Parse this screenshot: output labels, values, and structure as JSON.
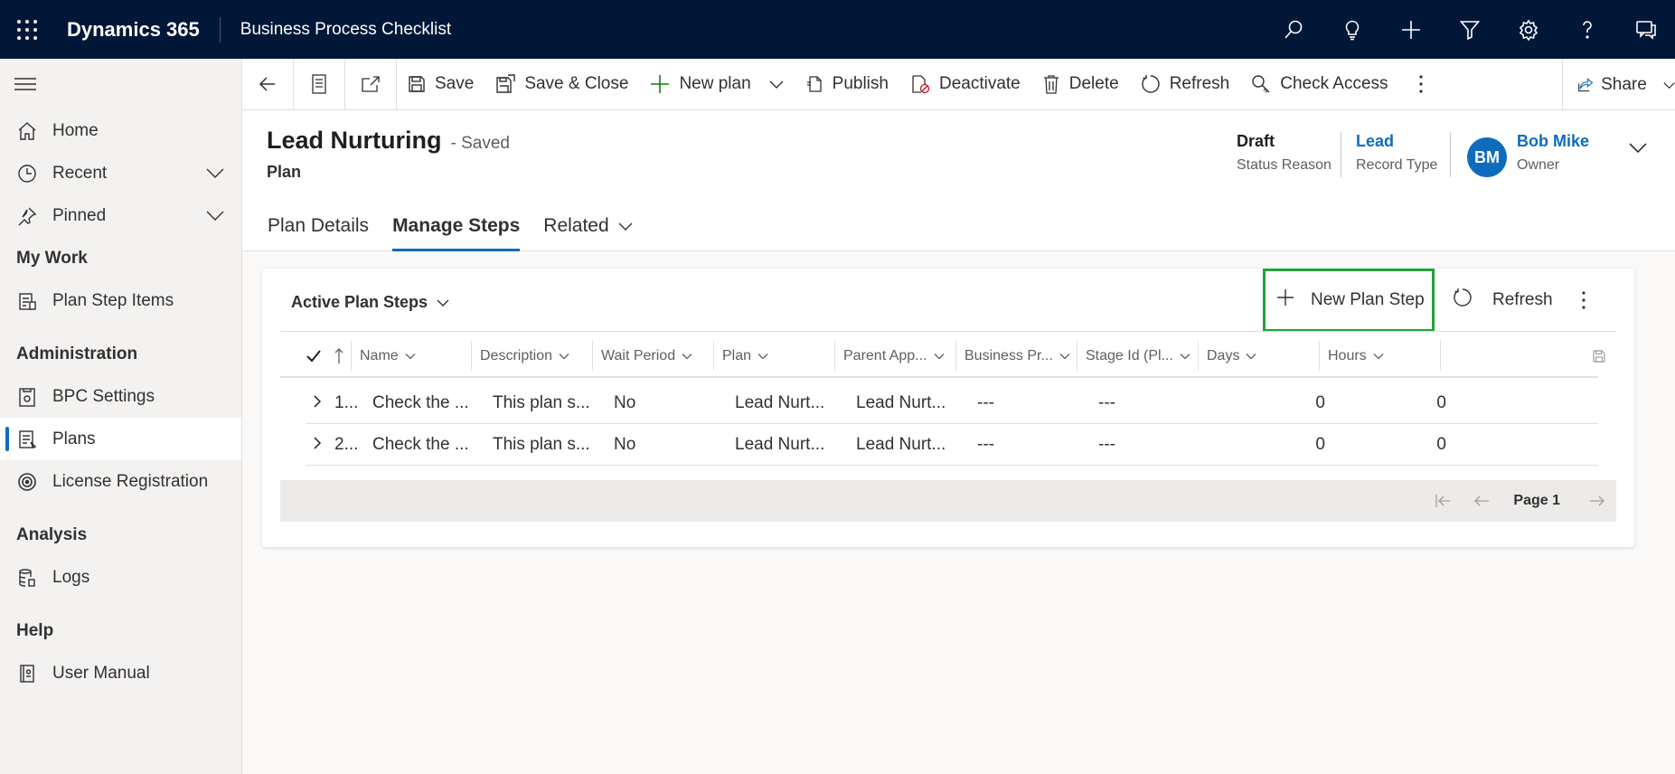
{
  "topbar": {
    "app_name": "Dynamics 365",
    "app_sub": "Business Process Checklist",
    "icons": [
      "search-icon",
      "lightbulb-icon",
      "plus-icon",
      "filter-icon",
      "gear-icon",
      "help-icon",
      "chat-icon"
    ]
  },
  "sidebar": {
    "items": [
      {
        "label": "Home",
        "icon": "home-icon"
      },
      {
        "label": "Recent",
        "icon": "clock-icon"
      },
      {
        "label": "Pinned",
        "icon": "pin-icon"
      }
    ],
    "sections": [
      {
        "title": "My Work",
        "items": [
          {
            "label": "Plan Step Items",
            "icon": "checklist-icon"
          }
        ]
      },
      {
        "title": "Administration",
        "items": [
          {
            "label": "BPC Settings",
            "icon": "settings-doc-icon"
          },
          {
            "label": "Plans",
            "icon": "plans-icon"
          },
          {
            "label": "License Registration",
            "icon": "license-icon"
          }
        ]
      },
      {
        "title": "Analysis",
        "items": [
          {
            "label": "Logs",
            "icon": "logs-icon"
          }
        ]
      },
      {
        "title": "Help",
        "items": [
          {
            "label": "User Manual",
            "icon": "manual-icon"
          }
        ]
      }
    ]
  },
  "cmdbar": {
    "save": "Save",
    "save_close": "Save & Close",
    "new_plan": "New plan",
    "publish": "Publish",
    "deactivate": "Deactivate",
    "delete": "Delete",
    "refresh": "Refresh",
    "check_access": "Check Access",
    "share": "Share"
  },
  "record": {
    "title": "Lead Nurturing",
    "saved": "- Saved",
    "entity": "Plan",
    "status_value": "Draft",
    "status_label": "Status Reason",
    "type_value": "Lead",
    "type_label": "Record Type",
    "owner_initials": "BM",
    "owner_value": "Bob Mike",
    "owner_label": "Owner"
  },
  "tabs": [
    "Plan Details",
    "Manage Steps",
    "Related"
  ],
  "grid": {
    "view": "Active Plan Steps",
    "new_step": "New Plan Step",
    "refresh": "Refresh",
    "columns": [
      "Name",
      "Description",
      "Wait Period",
      "Plan",
      "Parent App...",
      "Business Pr...",
      "Stage Id (Pl...",
      "Days",
      "Hours"
    ],
    "rows": [
      {
        "num": "1...",
        "name": "Check the ...",
        "description": "This plan s...",
        "wait": "No",
        "plan": "Lead Nurt...",
        "parent": "Lead Nurt...",
        "bp": "---",
        "stage": "---",
        "days": "0",
        "hours": "0"
      },
      {
        "num": "2...",
        "name": "Check the ...",
        "description": "This plan s...",
        "wait": "No",
        "plan": "Lead Nurt...",
        "parent": "Lead Nurt...",
        "bp": "---",
        "stage": "---",
        "days": "0",
        "hours": "0"
      }
    ],
    "page": "Page 1"
  },
  "colors": {
    "topbar": "#001737",
    "accent": "#0f6cbd",
    "highlight": "#21a338"
  }
}
